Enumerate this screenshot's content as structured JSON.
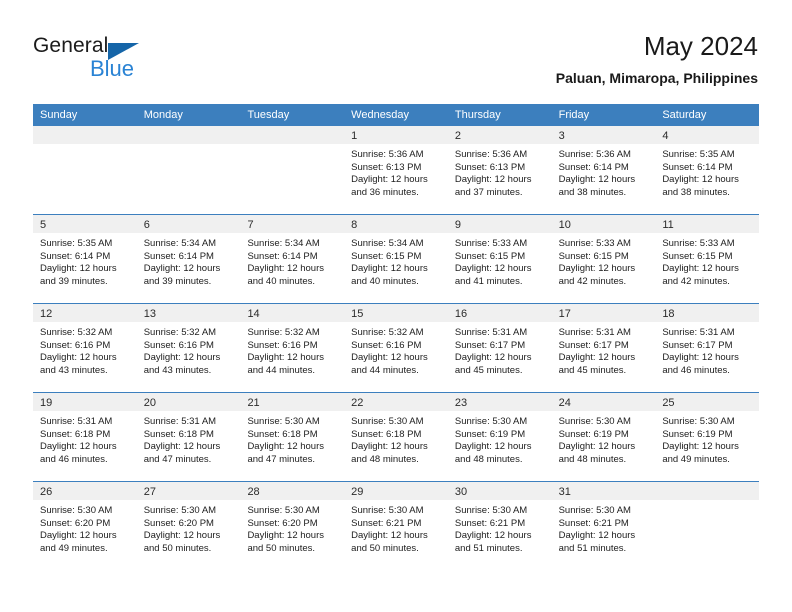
{
  "brand": {
    "word1": "General",
    "word2": "Blue",
    "triangle_color": "#1565a8",
    "blue_color": "#2a83d4"
  },
  "header": {
    "title": "May 2024",
    "subtitle": "Paluan, Mimaropa, Philippines"
  },
  "theme": {
    "header_blue": "#3c7fbe",
    "day_band_gray": "#f0f0f0",
    "text": "#1a1a1a"
  },
  "weekdays": [
    "Sunday",
    "Monday",
    "Tuesday",
    "Wednesday",
    "Thursday",
    "Friday",
    "Saturday"
  ],
  "weeks": [
    [
      {
        "day": "",
        "empty": true,
        "sunrise": "",
        "sunset": "",
        "daylight1": "",
        "daylight2": ""
      },
      {
        "day": "",
        "empty": true,
        "sunrise": "",
        "sunset": "",
        "daylight1": "",
        "daylight2": ""
      },
      {
        "day": "",
        "empty": true,
        "sunrise": "",
        "sunset": "",
        "daylight1": "",
        "daylight2": ""
      },
      {
        "day": "1",
        "empty": false,
        "sunrise": "Sunrise: 5:36 AM",
        "sunset": "Sunset: 6:13 PM",
        "daylight1": "Daylight: 12 hours",
        "daylight2": "and 36 minutes."
      },
      {
        "day": "2",
        "empty": false,
        "sunrise": "Sunrise: 5:36 AM",
        "sunset": "Sunset: 6:13 PM",
        "daylight1": "Daylight: 12 hours",
        "daylight2": "and 37 minutes."
      },
      {
        "day": "3",
        "empty": false,
        "sunrise": "Sunrise: 5:36 AM",
        "sunset": "Sunset: 6:14 PM",
        "daylight1": "Daylight: 12 hours",
        "daylight2": "and 38 minutes."
      },
      {
        "day": "4",
        "empty": false,
        "sunrise": "Sunrise: 5:35 AM",
        "sunset": "Sunset: 6:14 PM",
        "daylight1": "Daylight: 12 hours",
        "daylight2": "and 38 minutes."
      }
    ],
    [
      {
        "day": "5",
        "empty": false,
        "sunrise": "Sunrise: 5:35 AM",
        "sunset": "Sunset: 6:14 PM",
        "daylight1": "Daylight: 12 hours",
        "daylight2": "and 39 minutes."
      },
      {
        "day": "6",
        "empty": false,
        "sunrise": "Sunrise: 5:34 AM",
        "sunset": "Sunset: 6:14 PM",
        "daylight1": "Daylight: 12 hours",
        "daylight2": "and 39 minutes."
      },
      {
        "day": "7",
        "empty": false,
        "sunrise": "Sunrise: 5:34 AM",
        "sunset": "Sunset: 6:14 PM",
        "daylight1": "Daylight: 12 hours",
        "daylight2": "and 40 minutes."
      },
      {
        "day": "8",
        "empty": false,
        "sunrise": "Sunrise: 5:34 AM",
        "sunset": "Sunset: 6:15 PM",
        "daylight1": "Daylight: 12 hours",
        "daylight2": "and 40 minutes."
      },
      {
        "day": "9",
        "empty": false,
        "sunrise": "Sunrise: 5:33 AM",
        "sunset": "Sunset: 6:15 PM",
        "daylight1": "Daylight: 12 hours",
        "daylight2": "and 41 minutes."
      },
      {
        "day": "10",
        "empty": false,
        "sunrise": "Sunrise: 5:33 AM",
        "sunset": "Sunset: 6:15 PM",
        "daylight1": "Daylight: 12 hours",
        "daylight2": "and 42 minutes."
      },
      {
        "day": "11",
        "empty": false,
        "sunrise": "Sunrise: 5:33 AM",
        "sunset": "Sunset: 6:15 PM",
        "daylight1": "Daylight: 12 hours",
        "daylight2": "and 42 minutes."
      }
    ],
    [
      {
        "day": "12",
        "empty": false,
        "sunrise": "Sunrise: 5:32 AM",
        "sunset": "Sunset: 6:16 PM",
        "daylight1": "Daylight: 12 hours",
        "daylight2": "and 43 minutes."
      },
      {
        "day": "13",
        "empty": false,
        "sunrise": "Sunrise: 5:32 AM",
        "sunset": "Sunset: 6:16 PM",
        "daylight1": "Daylight: 12 hours",
        "daylight2": "and 43 minutes."
      },
      {
        "day": "14",
        "empty": false,
        "sunrise": "Sunrise: 5:32 AM",
        "sunset": "Sunset: 6:16 PM",
        "daylight1": "Daylight: 12 hours",
        "daylight2": "and 44 minutes."
      },
      {
        "day": "15",
        "empty": false,
        "sunrise": "Sunrise: 5:32 AM",
        "sunset": "Sunset: 6:16 PM",
        "daylight1": "Daylight: 12 hours",
        "daylight2": "and 44 minutes."
      },
      {
        "day": "16",
        "empty": false,
        "sunrise": "Sunrise: 5:31 AM",
        "sunset": "Sunset: 6:17 PM",
        "daylight1": "Daylight: 12 hours",
        "daylight2": "and 45 minutes."
      },
      {
        "day": "17",
        "empty": false,
        "sunrise": "Sunrise: 5:31 AM",
        "sunset": "Sunset: 6:17 PM",
        "daylight1": "Daylight: 12 hours",
        "daylight2": "and 45 minutes."
      },
      {
        "day": "18",
        "empty": false,
        "sunrise": "Sunrise: 5:31 AM",
        "sunset": "Sunset: 6:17 PM",
        "daylight1": "Daylight: 12 hours",
        "daylight2": "and 46 minutes."
      }
    ],
    [
      {
        "day": "19",
        "empty": false,
        "sunrise": "Sunrise: 5:31 AM",
        "sunset": "Sunset: 6:18 PM",
        "daylight1": "Daylight: 12 hours",
        "daylight2": "and 46 minutes."
      },
      {
        "day": "20",
        "empty": false,
        "sunrise": "Sunrise: 5:31 AM",
        "sunset": "Sunset: 6:18 PM",
        "daylight1": "Daylight: 12 hours",
        "daylight2": "and 47 minutes."
      },
      {
        "day": "21",
        "empty": false,
        "sunrise": "Sunrise: 5:30 AM",
        "sunset": "Sunset: 6:18 PM",
        "daylight1": "Daylight: 12 hours",
        "daylight2": "and 47 minutes."
      },
      {
        "day": "22",
        "empty": false,
        "sunrise": "Sunrise: 5:30 AM",
        "sunset": "Sunset: 6:18 PM",
        "daylight1": "Daylight: 12 hours",
        "daylight2": "and 48 minutes."
      },
      {
        "day": "23",
        "empty": false,
        "sunrise": "Sunrise: 5:30 AM",
        "sunset": "Sunset: 6:19 PM",
        "daylight1": "Daylight: 12 hours",
        "daylight2": "and 48 minutes."
      },
      {
        "day": "24",
        "empty": false,
        "sunrise": "Sunrise: 5:30 AM",
        "sunset": "Sunset: 6:19 PM",
        "daylight1": "Daylight: 12 hours",
        "daylight2": "and 48 minutes."
      },
      {
        "day": "25",
        "empty": false,
        "sunrise": "Sunrise: 5:30 AM",
        "sunset": "Sunset: 6:19 PM",
        "daylight1": "Daylight: 12 hours",
        "daylight2": "and 49 minutes."
      }
    ],
    [
      {
        "day": "26",
        "empty": false,
        "sunrise": "Sunrise: 5:30 AM",
        "sunset": "Sunset: 6:20 PM",
        "daylight1": "Daylight: 12 hours",
        "daylight2": "and 49 minutes."
      },
      {
        "day": "27",
        "empty": false,
        "sunrise": "Sunrise: 5:30 AM",
        "sunset": "Sunset: 6:20 PM",
        "daylight1": "Daylight: 12 hours",
        "daylight2": "and 50 minutes."
      },
      {
        "day": "28",
        "empty": false,
        "sunrise": "Sunrise: 5:30 AM",
        "sunset": "Sunset: 6:20 PM",
        "daylight1": "Daylight: 12 hours",
        "daylight2": "and 50 minutes."
      },
      {
        "day": "29",
        "empty": false,
        "sunrise": "Sunrise: 5:30 AM",
        "sunset": "Sunset: 6:21 PM",
        "daylight1": "Daylight: 12 hours",
        "daylight2": "and 50 minutes."
      },
      {
        "day": "30",
        "empty": false,
        "sunrise": "Sunrise: 5:30 AM",
        "sunset": "Sunset: 6:21 PM",
        "daylight1": "Daylight: 12 hours",
        "daylight2": "and 51 minutes."
      },
      {
        "day": "31",
        "empty": false,
        "sunrise": "Sunrise: 5:30 AM",
        "sunset": "Sunset: 6:21 PM",
        "daylight1": "Daylight: 12 hours",
        "daylight2": "and 51 minutes."
      },
      {
        "day": "",
        "empty": true,
        "sunrise": "",
        "sunset": "",
        "daylight1": "",
        "daylight2": ""
      }
    ]
  ]
}
